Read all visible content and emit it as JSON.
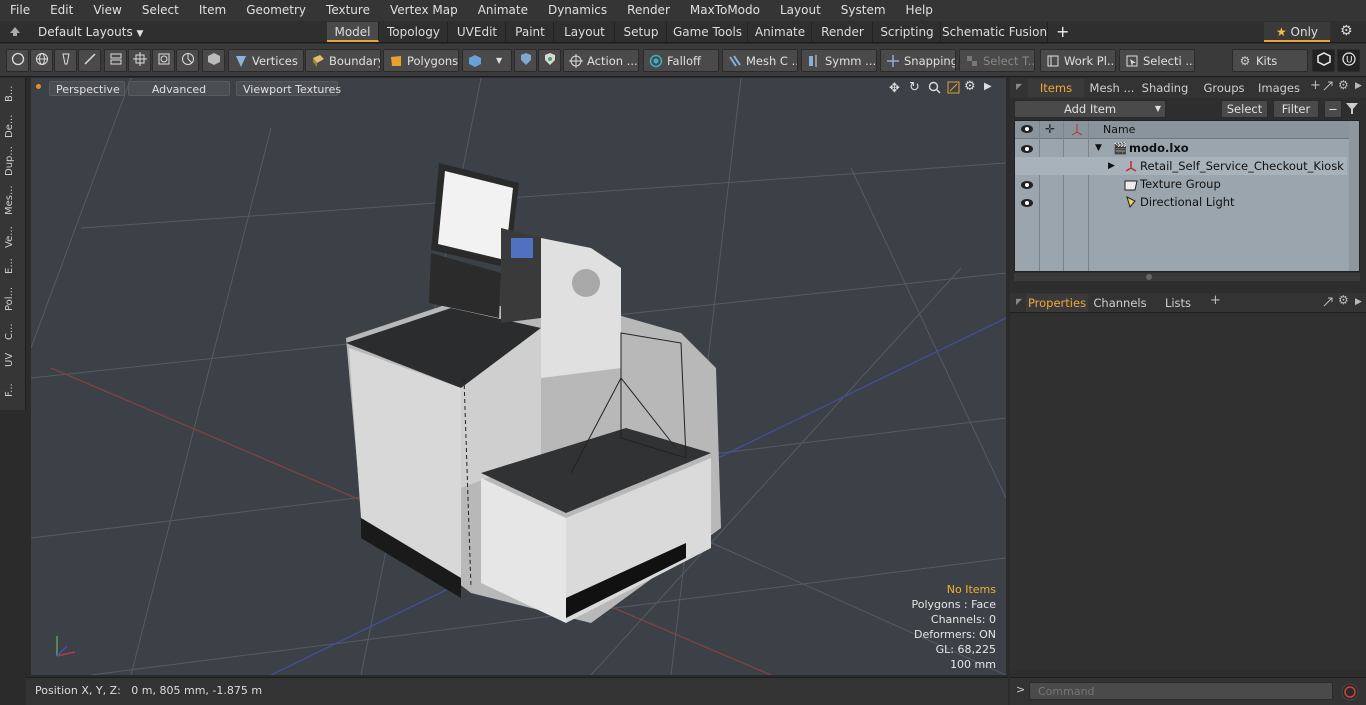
{
  "menu": [
    "File",
    "Edit",
    "View",
    "Select",
    "Item",
    "Geometry",
    "Texture",
    "Vertex Map",
    "Animate",
    "Dynamics",
    "Render",
    "MaxToModo",
    "Layout",
    "System",
    "Help"
  ],
  "layouts": {
    "label": "Default Layouts"
  },
  "tabs": [
    "Model",
    "Topology",
    "UVEdit",
    "Paint",
    "Layout",
    "Setup",
    "Game Tools",
    "Animate",
    "Render",
    "Scripting",
    "Schematic Fusion"
  ],
  "only_label": "Only",
  "toolbar": {
    "vertices": "Vertices",
    "boundary": "Boundary",
    "polygons": "Polygons",
    "action": "Action ...",
    "falloff": "Falloff",
    "mesh": "Mesh C ...",
    "symm": "Symm ...",
    "snapping": "Snapping",
    "select_t": "Select T...",
    "work": "Work Pl...",
    "selecti": "Selecti ...",
    "kits": "Kits"
  },
  "left_tabs": [
    "B...",
    "De...",
    "Dup...",
    "Mes...",
    "Ve...",
    "E...",
    "Pol...",
    "C...",
    "UV",
    "F..."
  ],
  "viewport": {
    "perspective": "Perspective",
    "advanced": "Advanced",
    "viewport_textures": "Viewport Textures"
  },
  "stats": {
    "no_items": "No Items",
    "polygons": "Polygons : Face",
    "channels": "Channels: 0",
    "deformers": "Deformers: ON",
    "gl": "GL: 68,225",
    "scale": "100 mm"
  },
  "status": {
    "position": "Position X, Y, Z:   0 m, 805 mm, -1.875 m"
  },
  "right_tabs": [
    "Items",
    "Mesh ...",
    "Shading",
    "Groups",
    "Images"
  ],
  "items_panel": {
    "add_item": "Add Item",
    "select": "Select",
    "filter": "Filter",
    "name_header": "Name",
    "rows": [
      {
        "label": "modo.lxo"
      },
      {
        "label": "Retail_Self_Service_Checkout_Kiosk"
      },
      {
        "label": "Texture Group"
      },
      {
        "label": "Directional Light"
      }
    ]
  },
  "props_tabs": [
    "Properties",
    "Channels",
    "Lists"
  ],
  "command": {
    "placeholder": "Command"
  },
  "colors": {
    "accent": "#f0a83a",
    "viewport_bg": "#3c4147",
    "list_bg": "#9aa5ae"
  }
}
